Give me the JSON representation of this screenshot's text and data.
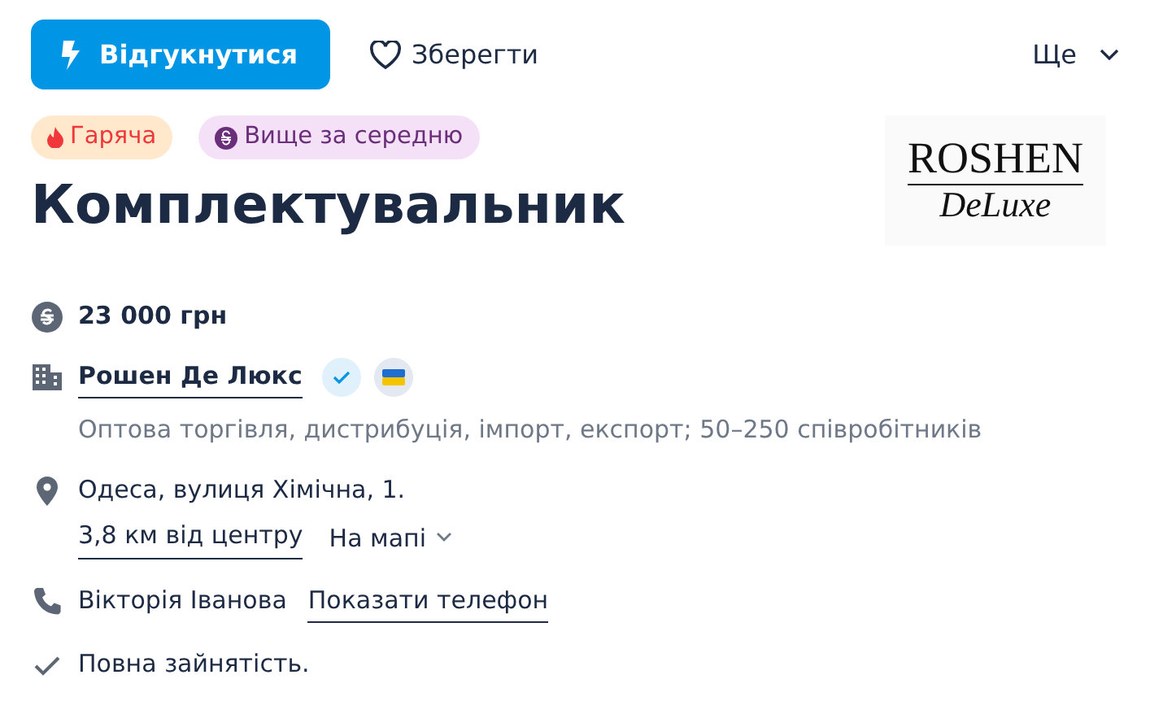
{
  "actions": {
    "apply": "Відгукнутися",
    "save": "Зберегти",
    "more": "Ще"
  },
  "tags": [
    {
      "kind": "hot",
      "label": "Гаряча"
    },
    {
      "kind": "salary",
      "label": "Вище за середню"
    }
  ],
  "title": "Комплектувальник",
  "logo": {
    "line_1": "ROSHEN",
    "line_2": "DeLuxe"
  },
  "salary": "23 000 грн",
  "company": {
    "name": "Рошен Де Люкс",
    "verified": true,
    "ukrainian": true,
    "description": "Оптова торгівля, дистрибуція, імпорт, експорт; 50–250 співробітників"
  },
  "address": {
    "text": "Одеса, вулиця Хімічна, 1.",
    "distance": "3,8 км від центру",
    "map": "На мапі",
    "map_expanded": false
  },
  "contact": {
    "name": "Вікторія Іванова",
    "phone_link": "Показати телефон"
  },
  "employment": "Повна зайнятість."
}
